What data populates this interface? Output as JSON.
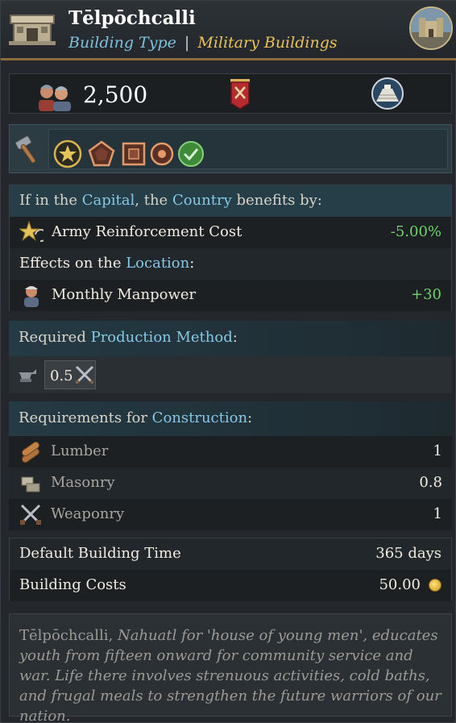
{
  "header": {
    "title": "Tēlpōchcalli",
    "type_label": "Building Type",
    "separator": "|",
    "category": "Military Buildings"
  },
  "stats": {
    "manpower": "2,500"
  },
  "icons": {
    "building": "building-icon",
    "portrait": "castle-portrait-icon",
    "manpower": "soldiers-icon",
    "banner": "military-banner-icon",
    "pyramid": "pyramid-icon",
    "hammer": "hammer-icon",
    "tags": [
      "star-icon",
      "pentagon-icon",
      "square-icon",
      "circle-icon",
      "checkmark-icon"
    ]
  },
  "colors": {
    "accent": "#86c8e6",
    "category": "#e9c25c",
    "positive": "#6fd36c",
    "gold_border": "#8a6d3b"
  },
  "effects": {
    "capital_prefix": "If in the ",
    "capital": "Capital",
    "capital_mid": ", the ",
    "country": "Country",
    "capital_suffix": " benefits by:",
    "capital_effect_label": "Army Reinforcement Cost",
    "capital_effect_value": "-5.00%",
    "location_prefix": "Effects on the ",
    "location": "Location",
    "location_suffix": ":",
    "location_effect_label": "Monthly Manpower",
    "location_effect_value": "+30"
  },
  "production": {
    "prefix": "Required ",
    "highlight": "Production Method",
    "suffix": ":",
    "value": "0.5"
  },
  "requirements": {
    "prefix": "Requirements for ",
    "highlight": "Construction",
    "suffix": ":",
    "items": [
      {
        "label": "Lumber",
        "value": "1"
      },
      {
        "label": "Masonry",
        "value": "0.8"
      },
      {
        "label": "Weaponry",
        "value": "1"
      }
    ]
  },
  "building": {
    "time_label": "Default Building Time",
    "time_value": "365 days",
    "cost_label": "Building Costs",
    "cost_value": "50.00"
  },
  "description": {
    "name": "Tēlpōchcalli,",
    "text": " Nahuatl for 'house of young men', educates youth from fifteen onward for community service and war. Life there involves strenuous activities, cold baths, and frugal meals to strengthen the future warriors of our nation."
  }
}
